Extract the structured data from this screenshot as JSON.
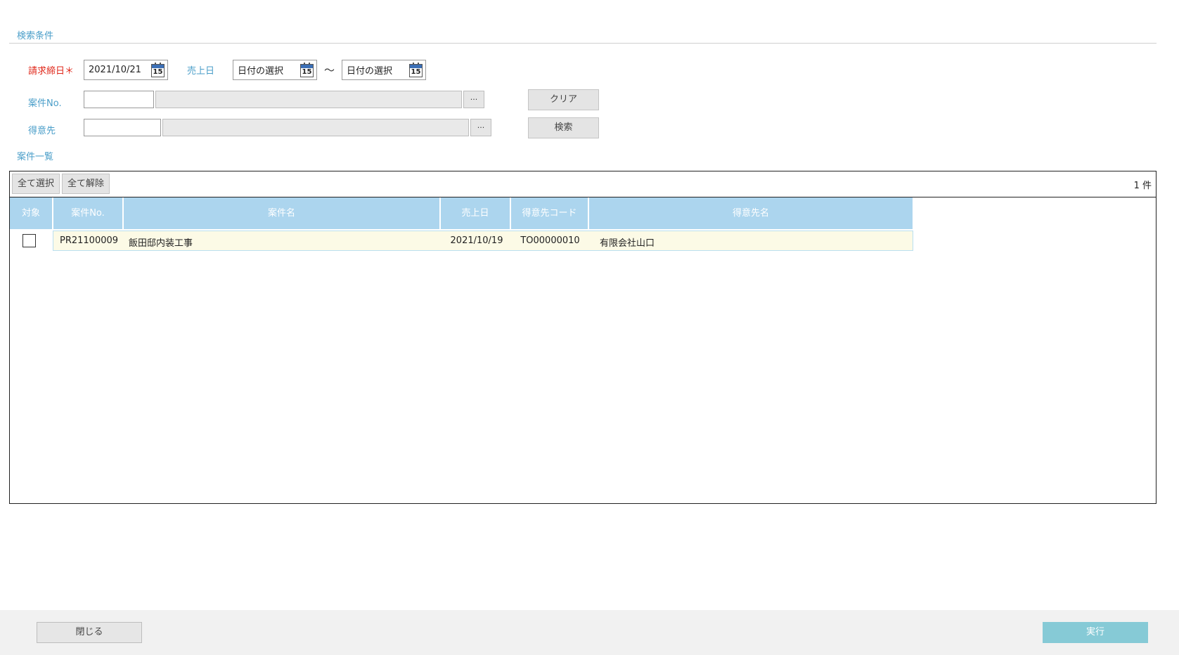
{
  "search": {
    "section_title": "検索条件",
    "closing_date_label": "請求締日＊",
    "closing_date_value": "2021/10/21",
    "sales_date_label": "売上日",
    "sales_date_from": "日付の選択",
    "tilde": "～",
    "sales_date_to": "日付の選択",
    "calendar_day": "15",
    "case_no_label": "案件No.",
    "customer_label": "得意先",
    "ellipsis": "···",
    "clear_button": "クリア",
    "search_button": "検索"
  },
  "list": {
    "section_title": "案件一覧",
    "select_all": "全て選択",
    "deselect_all": "全て解除",
    "count": "1 件",
    "columns": [
      "対象",
      "案件No.",
      "案件名",
      "売上日",
      "得意先コード",
      "得意先名"
    ],
    "rows": [
      {
        "checked": false,
        "case_no": "PR21100009",
        "case_name": "飯田邸内装工事",
        "sales_date": "2021/10/19",
        "customer_code": "TO00000010",
        "customer_name": "有限会社山口"
      }
    ]
  },
  "footer": {
    "close_button": "閉じる",
    "execute_button": "実行"
  },
  "colors": {
    "accent_text": "#4a9ec9",
    "required": "#e0281b",
    "header_bg": "#acd5ee",
    "row_bg": "#fcfae6",
    "execute_bg": "#86cad6"
  },
  "icons": [
    "calendar-icon",
    "ellipsis-icon"
  ]
}
